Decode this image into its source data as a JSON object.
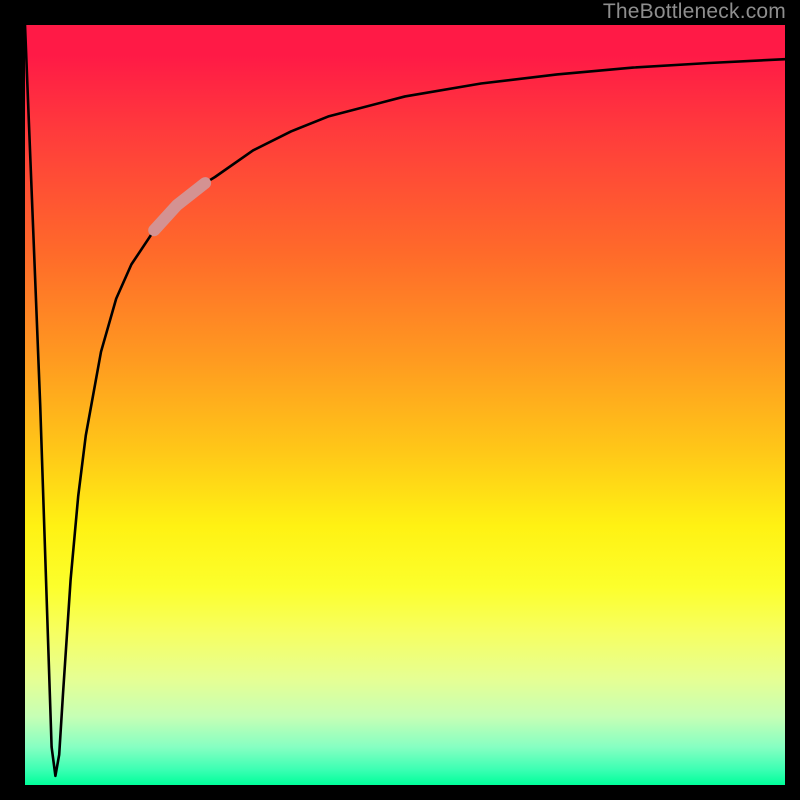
{
  "watermark": "TheBottleneck.com",
  "colors": {
    "background": "#000000",
    "curve_stroke": "#000000",
    "highlight_stroke": "#d49292",
    "gradient_top": "#ff1a46",
    "gradient_bottom": "#00ff9a",
    "watermark_text": "#8e8e8e"
  },
  "chart_data": {
    "type": "line",
    "title": "",
    "xlabel": "",
    "ylabel": "",
    "xlim": [
      0,
      100
    ],
    "ylim": [
      0,
      100
    ],
    "grid": false,
    "legend": false,
    "annotations": [],
    "series": [
      {
        "name": "bottleneck-curve",
        "x": [
          0,
          1,
          2,
          3,
          3.5,
          4,
          4.5,
          5,
          6,
          7,
          8,
          10,
          12,
          14,
          17,
          20,
          23.7,
          25,
          30,
          35,
          40,
          50,
          60,
          70,
          80,
          90,
          100
        ],
        "y": [
          100,
          75,
          50,
          20,
          5,
          1.2,
          4,
          12,
          27,
          38,
          46,
          57,
          64,
          68.5,
          73,
          76.3,
          79.2,
          80,
          83.5,
          86,
          88,
          90.6,
          92.3,
          93.5,
          94.4,
          95,
          95.5
        ]
      }
    ],
    "highlight_segment": {
      "series": "bottleneck-curve",
      "x_start": 17,
      "x_end": 23.7,
      "note": "thicker muted-red overlay on the curve between these x values"
    },
    "background_gradient": {
      "direction": "vertical",
      "stops": [
        {
          "pos": 0.0,
          "color": "#ff1a46"
        },
        {
          "pos": 0.3,
          "color": "#ff6a2a"
        },
        {
          "pos": 0.56,
          "color": "#ffc718"
        },
        {
          "pos": 0.74,
          "color": "#fcff2c"
        },
        {
          "pos": 0.91,
          "color": "#c6ffb5"
        },
        {
          "pos": 1.0,
          "color": "#00ff9a"
        }
      ]
    }
  }
}
